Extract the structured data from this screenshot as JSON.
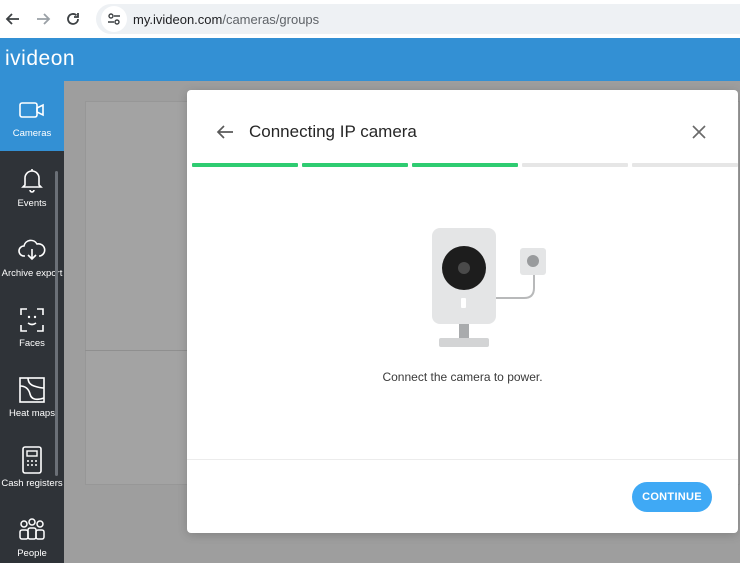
{
  "browser": {
    "url_host": "my.ivideon.com",
    "url_path": "/cameras/groups"
  },
  "app": {
    "logo": "ivideon"
  },
  "sidebar": {
    "items": [
      {
        "label": "Cameras",
        "icon": "camera-icon",
        "active": true
      },
      {
        "label": "Events",
        "icon": "bell-icon",
        "active": false
      },
      {
        "label": "Archive export",
        "icon": "cloud-download-icon",
        "active": false
      },
      {
        "label": "Faces",
        "icon": "face-scan-icon",
        "active": false
      },
      {
        "label": "Heat maps",
        "icon": "heat-map-icon",
        "active": false
      },
      {
        "label": "Cash registers",
        "icon": "cash-register-icon",
        "active": false
      },
      {
        "label": "People",
        "icon": "people-icon",
        "active": false
      }
    ]
  },
  "modal": {
    "title": "Connecting IP camera",
    "progress": {
      "total_steps": 5,
      "completed_steps": 3
    },
    "instruction": "Connect the camera to power.",
    "continue_label": "CONTINUE"
  },
  "colors": {
    "header": "#3390d4",
    "sidebar": "#2f3338",
    "progress_done": "#2ecc71",
    "progress_pending": "#e6e6e6",
    "button": "#3fa9f5"
  }
}
